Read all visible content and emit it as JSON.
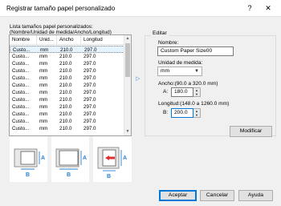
{
  "window": {
    "title": "Registrar tamaño papel personalizado",
    "help_glyph": "?",
    "close_glyph": "✕"
  },
  "list": {
    "caption_line1": "Lista tamaños papel personalizados:",
    "caption_line2": "(Nombre/Unidad de medida/Ancho/Longitud)",
    "columns": [
      "Nombre",
      "Unid...",
      "Ancho",
      "Longitud"
    ],
    "rows": [
      [
        "Custo...",
        "mm",
        "210.0",
        "297.0"
      ],
      [
        "Custo...",
        "mm",
        "210.0",
        "297.0"
      ],
      [
        "Custo...",
        "mm",
        "210.0",
        "297.0"
      ],
      [
        "Custo...",
        "mm",
        "210.0",
        "297.0"
      ],
      [
        "Custo...",
        "mm",
        "210.0",
        "297.0"
      ],
      [
        "Custo...",
        "mm",
        "210.0",
        "297.0"
      ],
      [
        "Custo...",
        "mm",
        "210.0",
        "297.0"
      ],
      [
        "Custo...",
        "mm",
        "210.0",
        "297.0"
      ],
      [
        "Custo...",
        "mm",
        "210.0",
        "297.0"
      ],
      [
        "Custo...",
        "mm",
        "210.0",
        "297.0"
      ],
      [
        "Custo...",
        "mm",
        "210.0",
        "297.0"
      ],
      [
        "Custo...",
        "mm",
        "210.0",
        "297.0"
      ]
    ],
    "selected_row_index": 0
  },
  "transfer_arrow": "▷",
  "edit": {
    "legend": "Editar",
    "name_label": "Nombre:",
    "name_value": "Custom Paper Size00",
    "unit_label": "Unidad de medida:",
    "unit_value": "mm",
    "width_label": "Ancho:(90.0 a 320.0 mm)",
    "width_prefix": "A:",
    "width_value": "180.0",
    "length_label": "Longitud:(148.0 a 1260.0 mm)",
    "length_prefix": "B:",
    "length_value": "200.0"
  },
  "buttons": {
    "modify": "Modificar",
    "accept": "Aceptar",
    "cancel": "Cancelar",
    "help": "Ayuda"
  },
  "illustration": {
    "label_a": "A",
    "label_b": "B",
    "accent_color": "#2a7fd0",
    "highlight_color": "#e03030"
  }
}
